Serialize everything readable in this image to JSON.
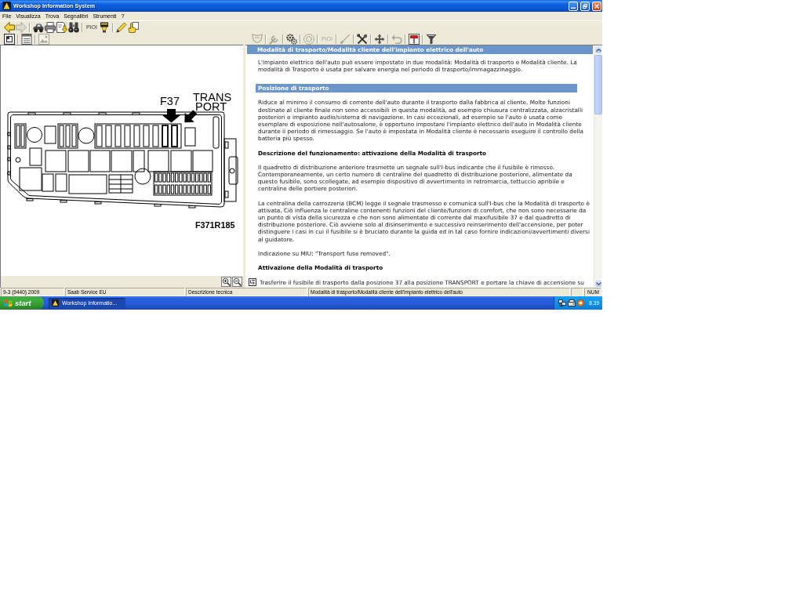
{
  "window": {
    "title": "Workshop Information System"
  },
  "menu": [
    "File",
    "Visualizza",
    "Trova",
    "Segnalibri",
    "Strumenti",
    "?"
  ],
  "main_toolbar": {
    "groups": [
      [
        {
          "kind": "icon",
          "disabled": false
        },
        {
          "kind": "icon",
          "disabled": true
        }
      ],
      [
        {
          "kind": "icon",
          "disabled": false
        },
        {
          "kind": "icon",
          "disabled": false
        },
        {
          "kind": "icon",
          "disabled": false
        },
        {
          "kind": "icon",
          "disabled": false
        }
      ],
      [
        {
          "kind": "text",
          "label": "PIOI",
          "disabled": false
        },
        {
          "kind": "icon",
          "disabled": false
        }
      ],
      [
        {
          "kind": "icon",
          "disabled": false
        },
        {
          "kind": "icon",
          "disabled": false
        }
      ]
    ]
  },
  "view_toolbar": {
    "items": [
      {
        "kind": "icon",
        "disabled": false
      },
      {
        "kind": "icon",
        "disabled": false
      },
      {
        "kind": "icon",
        "disabled": true
      }
    ]
  },
  "document_toolbar": {
    "items": [
      {
        "kind": "icon",
        "disabled": true
      },
      {
        "kind": "icon",
        "disabled": true
      },
      {
        "kind": "icon",
        "disabled": false
      },
      {
        "kind": "icon",
        "disabled": true
      },
      {
        "kind": "text",
        "label": "PIOI",
        "disabled": true
      },
      {
        "kind": "icon",
        "disabled": true
      },
      {
        "kind": "icon",
        "disabled": false
      },
      {
        "kind": "icon",
        "disabled": false
      },
      {
        "kind": "icon",
        "disabled": true
      },
      {
        "kind": "icon",
        "disabled": false
      },
      {
        "kind": "icon",
        "disabled": false
      }
    ]
  },
  "figure": {
    "callouts": [
      "F37",
      "TRANS",
      "PORT"
    ],
    "code": "F371R185"
  },
  "document": {
    "title": "Modalità di trasporto/Modalità cliente dell'impianto elettrico dell'auto",
    "blocks": [
      {
        "kind": "paragraph",
        "text": "L'impianto elettrico dell'auto può essere impostato in due modalità: Modalità di trasporto e Modalità cliente. La modalità di Trasporto è usata per salvare energia nel periodo di trasporto/immagazzinaggio."
      },
      {
        "kind": "section",
        "text": "Posizione di trasporto"
      },
      {
        "kind": "paragraph",
        "text": "Riduce al minimo il consumo di corrente dell'auto durante il trasporto dalla fabbrica al cliente. Molte funzioni destinate al cliente finale non sono accessibili in questa modalità, ad esempio chiusura centralizzata, alzacristalli posteriori e impianto audio/sistema di navigazione. In casi eccezionali, ad esempio se l'auto è usata come esemplare di esposizione nell'autosalone, è opportuno impostare l'impianto elettrico dell'auto in Modalità cliente durante il periodo di rimessaggio. Se l'auto è impostata in Modalità cliente è necessario eseguire il controllo della batteria più spesso."
      },
      {
        "kind": "heading",
        "text": "Descrizione del funzionamento: attivazione della Modalità di trasporto"
      },
      {
        "kind": "paragraph",
        "text": "Il quadretto di distribuzione anteriore trasmette un segnale sull'I-bus indicante che il fusibile è rimosso. Contemporaneamente, un certo numero di centraline del quadretto di distribuzione posteriore, alimentate da questo fusibile, sono scollegate, ad esempio dispositivo di avvertimento in retromarcia, tettuccio apribile e centraline delle portiere posteriori."
      },
      {
        "kind": "paragraph",
        "text": "La centralina della carrozzeria (BCM) legge il segnale trasmesso e comunica sull'I-bus che la Modalità di trasporto è attivata. Ciò influenza le centraline contenenti funzioni del cliente/funzioni di comfort, che non sono necessarie da un punto di vista della sicurezza e che non sono alimentate di corrente dal maxifusibile 37 e dal quadretto di distribuzione posteriore. Ciò avviene solo al disinserimento e successivo reinserimento dell'accensione, per poter distinguere i casi in cui il fusibile si è bruciato durante la guida ed in tal caso fornire indicazioni/avvertimenti diversi al guidatore."
      },
      {
        "kind": "paragraph",
        "text": "Indicazione su MIU: \"Transport fuse removed\"."
      },
      {
        "kind": "heading",
        "text": "Attivazione della Modalità di trasporto"
      },
      {
        "kind": "step",
        "text": "Trasferire il fusibile di trasporto dalla posizione 37 alla posizione TRANSPORT e portare la chiave di accensione su"
      }
    ]
  },
  "status_bar": {
    "panels": [
      "9-3 (9440) 2009",
      "Saab Service EU",
      "Descrizione tecnica",
      "Modalità di trasporto/Modalità cliente dell'impianto elettrico dell'auto"
    ],
    "indicators": [
      "NUM"
    ]
  },
  "taskbar": {
    "start": "start",
    "tasks": [
      {
        "label": "Workshop Informatio...",
        "selected": true
      }
    ],
    "clock": "8.39"
  }
}
